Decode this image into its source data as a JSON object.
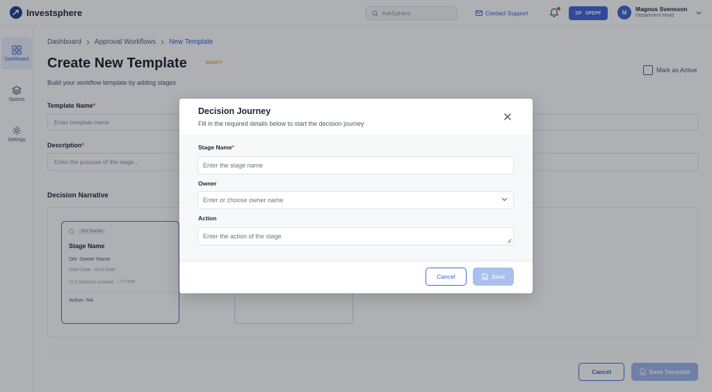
{
  "brand": {
    "name": "Investsphere"
  },
  "topbar": {
    "search_placeholder": "AskSphere",
    "contact_support": "Contact Support",
    "space_chip": {
      "initials": "SP",
      "label": "SPEPF"
    },
    "user": {
      "initial": "M",
      "name": "Magnus Svensson",
      "role": "Department Head"
    }
  },
  "sidebar": {
    "items": [
      {
        "label": "Dashboard",
        "icon": "grid-icon",
        "active": true
      },
      {
        "label": "Spaces",
        "icon": "layers-icon"
      },
      {
        "label": "Settings",
        "icon": "gear-icon"
      }
    ]
  },
  "breadcrumb": [
    "Dashboard",
    "Approval Workflows",
    "New Template"
  ],
  "page": {
    "title": "Create New Template",
    "status_badge": "DRAFT",
    "subtitle": "Build your workflow template by adding stages",
    "mark_active_label": "Mark as Active",
    "template_name_label": "Template Name",
    "template_name_placeholder": "Enter template name",
    "description_label": "Description",
    "description_placeholder": "Enter the purpose of the stage...",
    "required_mark": "*",
    "section_title": "Decision Narrative",
    "cancel_label": "Cancel",
    "save_template_label": "Save Template"
  },
  "stage_card": {
    "status": "Not Started",
    "name": "Stage Name",
    "owner_initials": "ON",
    "owner_name": "Owner Name",
    "dates": "Start Date  -  End Date",
    "artifacts": "0 artifacts created",
    "notes": "0 note",
    "action_label": "Action:",
    "action_value": "NA"
  },
  "modal": {
    "title": "Decision Journey",
    "subtitle": "Fill in the required details below to start the decision journey",
    "stage_name_label": "Stage Name",
    "stage_name_placeholder": "Enter the stage name",
    "owner_label": "Owner",
    "owner_placeholder": "Enter or choose owner name",
    "action_label": "Action",
    "action_placeholder": "Enter the action of the stage",
    "cancel_label": "Cancel",
    "save_label": "Save"
  },
  "colors": {
    "primary": "#3a66d6",
    "link": "#2f5bd3",
    "draft": "#e0a21a",
    "required": "#e04848"
  }
}
